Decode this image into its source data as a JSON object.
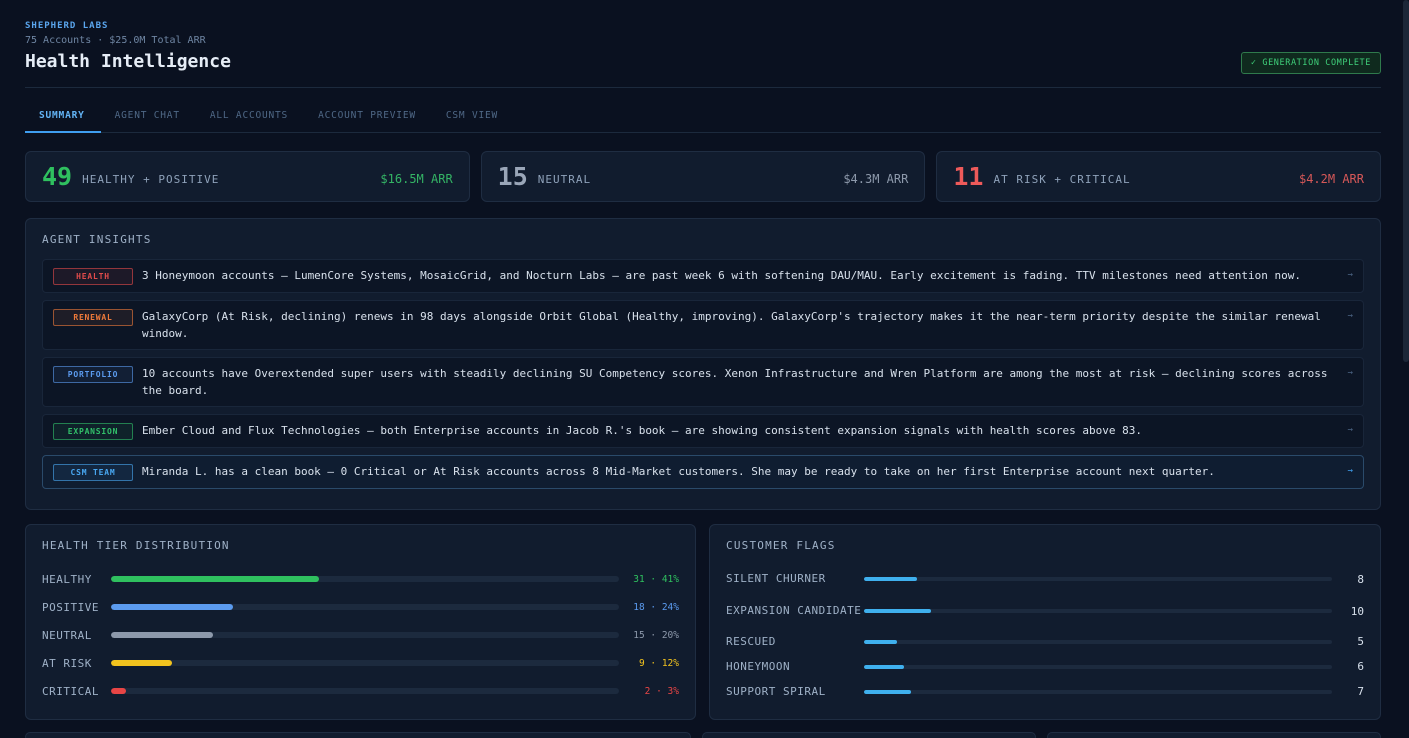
{
  "header": {
    "org": "SHEPHERD LABS",
    "subline": "75 Accounts · $25.0M Total ARR",
    "title": "Health Intelligence",
    "status_badge": "✓ GENERATION COMPLETE"
  },
  "tabs": [
    "SUMMARY",
    "AGENT CHAT",
    "ALL ACCOUNTS",
    "ACCOUNT PREVIEW",
    "CSM VIEW"
  ],
  "stats": [
    {
      "count": "49",
      "label": "HEALTHY + POSITIVE",
      "arr": "$16.5M ARR",
      "color": "#2fc05f",
      "arr_color": "#34b465"
    },
    {
      "count": "15",
      "label": "NEUTRAL",
      "arr": "$4.3M ARR",
      "color": "#9aa6b8",
      "arr_color": "#8d99ab"
    },
    {
      "count": "11",
      "label": "AT RISK + CRITICAL",
      "arr": "$4.2M ARR",
      "color": "#ee5a5a",
      "arr_color": "#d65858"
    }
  ],
  "insights": {
    "title": "AGENT INSIGHTS",
    "items": [
      {
        "tag": "HEALTH",
        "tag_color": "#e24b4b",
        "text": "3 Honeymoon accounts — LumenCore Systems, MosaicGrid, and Nocturn Labs — are past week 6 with softening DAU/MAU. Early excitement is fading. TTV milestones need attention now.",
        "arrow": "→"
      },
      {
        "tag": "RENEWAL",
        "tag_color": "#ef7a3a",
        "text": "GalaxyCorp (At Risk, declining) renews in 98 days alongside Orbit Global (Healthy, improving). GalaxyCorp's trajectory makes it the near-term priority despite the similar renewal window.",
        "arrow": "→"
      },
      {
        "tag": "PORTFOLIO",
        "tag_color": "#5b9bef",
        "text": "10 accounts have Overextended super users with steadily declining SU Competency scores. Xenon Infrastructure and Wren Platform are among the most at risk — declining scores across the board.",
        "arrow": "→"
      },
      {
        "tag": "EXPANSION",
        "tag_color": "#32c06a",
        "text": "Ember Cloud and Flux Technologies — both Enterprise accounts in Jacob R.'s book — are showing consistent expansion signals with health scores above 83.",
        "arrow": "→"
      },
      {
        "tag": "CSM TEAM",
        "tag_color": "#49a8f2",
        "text": "Miranda L. has a clean book — 0 Critical or At Risk accounts across 8 Mid-Market customers. She may be ready to take on her first Enterprise account next quarter.",
        "arrow": "→"
      }
    ]
  },
  "tiers": {
    "title": "HEALTH TIER DISTRIBUTION",
    "rows": [
      {
        "label": "HEALTHY",
        "pct": 41,
        "value": "31 · 41%",
        "color": "#2fc05f"
      },
      {
        "label": "POSITIVE",
        "pct": 24,
        "value": "18 · 24%",
        "color": "#5b9bef"
      },
      {
        "label": "NEUTRAL",
        "pct": 20,
        "value": "15 · 20%",
        "color": "#8d99ab"
      },
      {
        "label": "AT RISK",
        "pct": 12,
        "value": "9 · 12%",
        "color": "#f2c31e"
      },
      {
        "label": "CRITICAL",
        "pct": 3,
        "value": "2 · 3%",
        "color": "#e84545"
      }
    ]
  },
  "flags": {
    "title": "CUSTOMER FLAGS",
    "bar_color": "#3fb0ee",
    "rows": [
      {
        "label": "SILENT CHURNER",
        "count": 8
      },
      {
        "label": "EXPANSION CANDIDATE",
        "count": 10
      },
      {
        "label": "RESCUED",
        "count": 5
      },
      {
        "label": "HONEYMOON",
        "count": 6
      },
      {
        "label": "SUPPORT SPIRAL",
        "count": 7
      }
    ]
  }
}
